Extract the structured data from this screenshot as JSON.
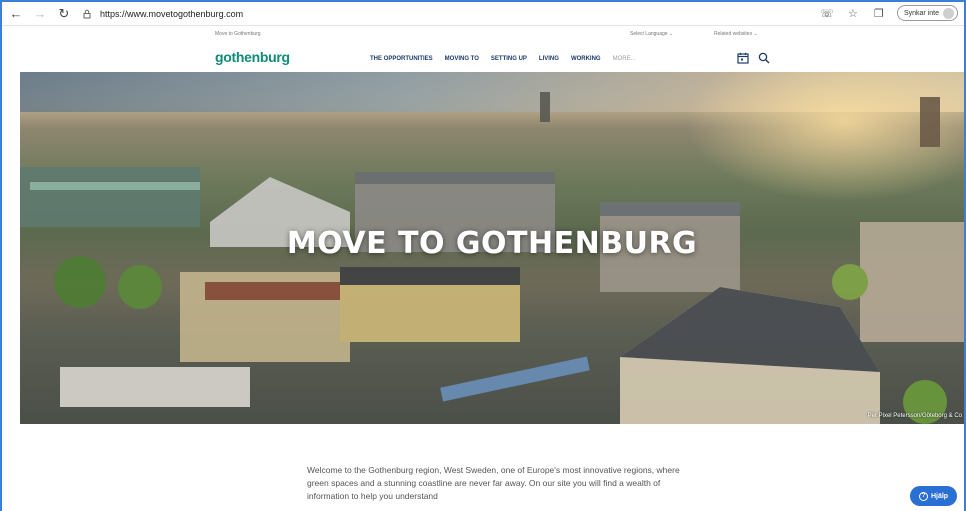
{
  "browser": {
    "url": "https://www.movetogothenburg.com",
    "sync_label": "Synkar inte"
  },
  "site": {
    "breadcrumb": "Move to Gothenburg",
    "language_label": "Select Language",
    "related_label": "Related websites",
    "logo_text": "gothenburg",
    "nav": [
      "THE OPPORTUNITIES",
      "MOVING TO",
      "SETTING UP",
      "LIVING",
      "WORKING",
      "MORE..."
    ]
  },
  "hero": {
    "title": "MOVE TO GOTHENBURG",
    "credit": "Per Pixel Petersson/Göteborg & Co"
  },
  "intro": {
    "text": "Welcome to the Gothenburg region, West Sweden, one of Europe's most innovative regions, where green spaces and a stunning coastline are never far away. On our site you will find a wealth of information to help you understand"
  },
  "help": {
    "label": "Hjälp"
  },
  "colors": {
    "brand": "#0e8c77",
    "nav": "#1e3a6b",
    "help": "#2a6fd4"
  }
}
